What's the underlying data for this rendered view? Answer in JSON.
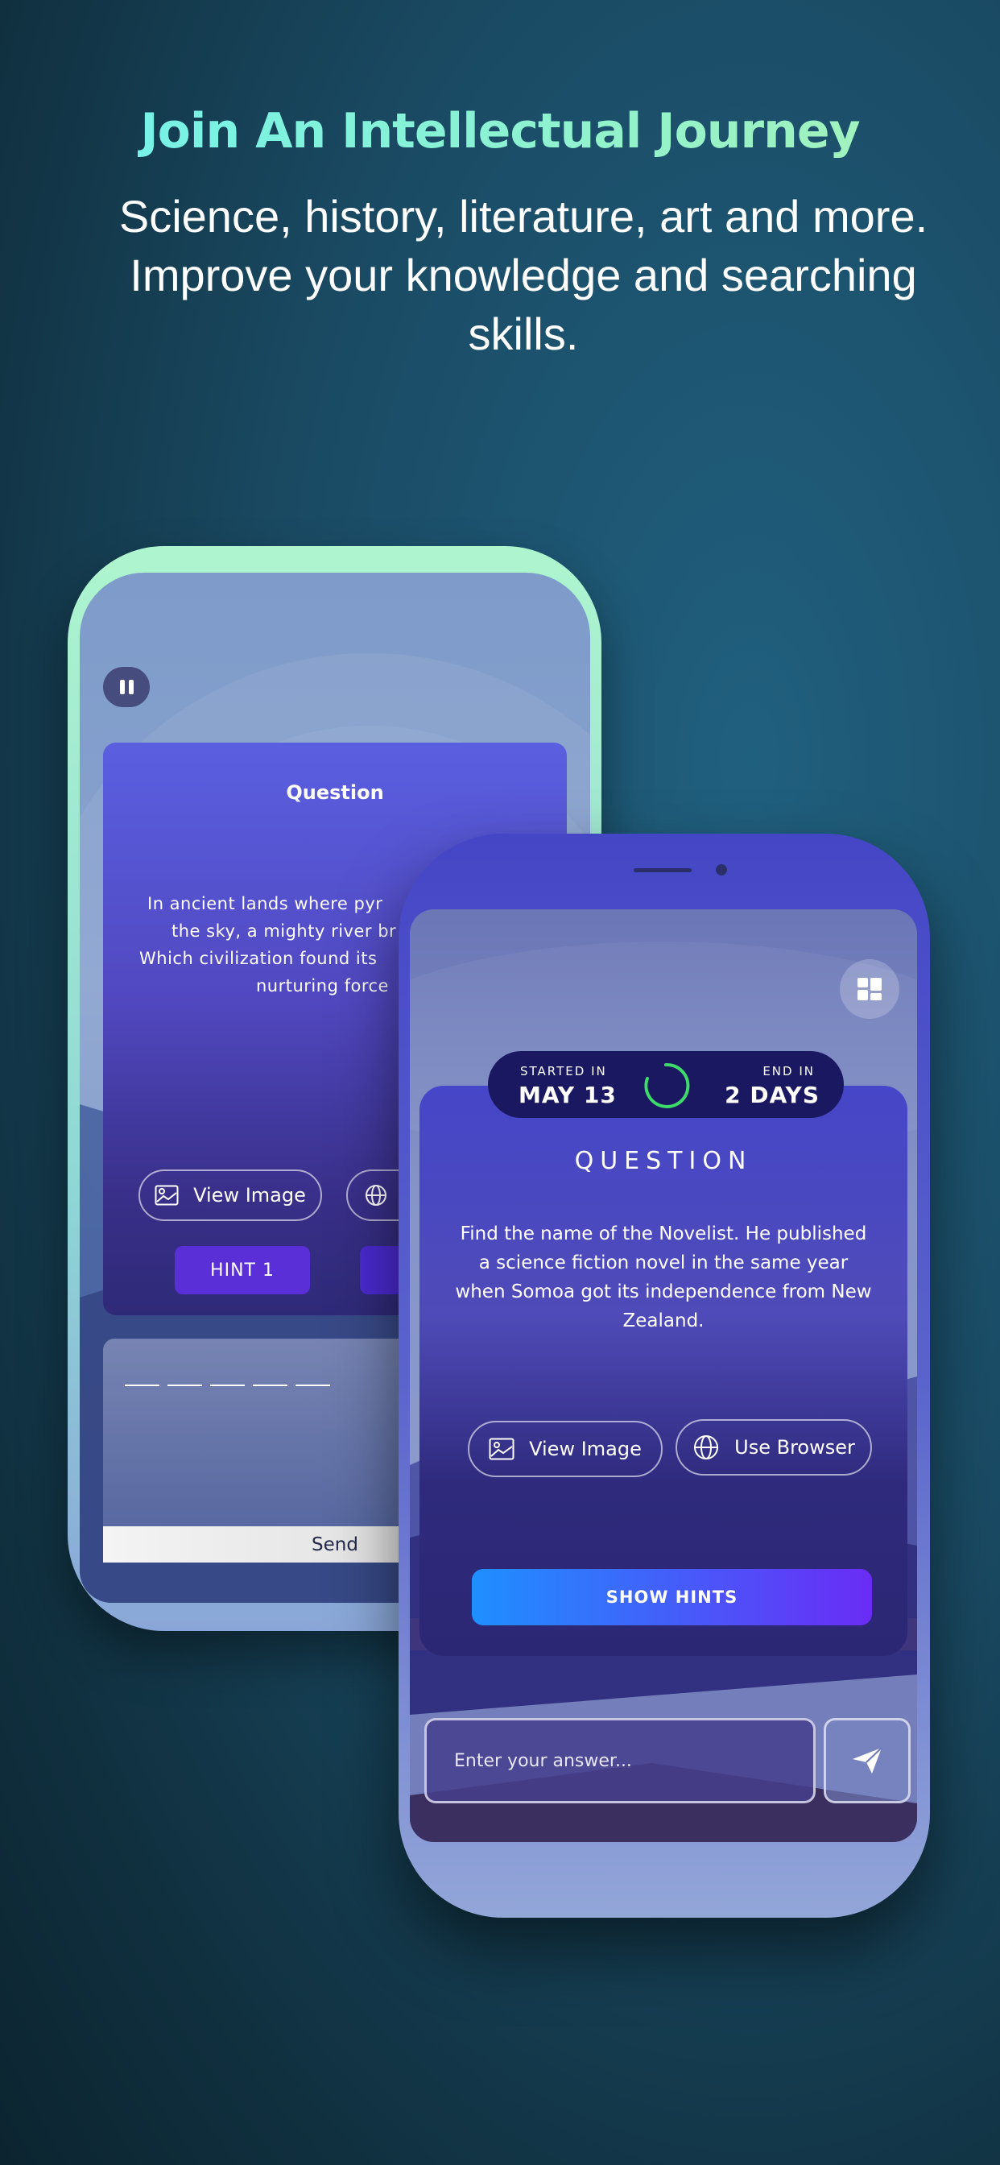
{
  "header": {
    "title": "Join An Intellectual Journey",
    "subtitle": "Science, history, literature, art and more. Improve your knowledge and searching skills."
  },
  "back_screen": {
    "pause_icon": "pause-icon",
    "question_title": "Question",
    "question_lines": [
      "In ancient lands where pyr",
      "the sky, a mighty river br",
      "Which civilization found its",
      "nurturing force"
    ],
    "view_image": "View Image",
    "hint1": "HINT 1",
    "send": "Send",
    "answer_slots": 5
  },
  "front_screen": {
    "menu_icon": "grid-icon",
    "started_label": "STARTED IN",
    "started_value": "MAY 13",
    "end_label": "END IN",
    "end_value": "2 DAYS",
    "question_title": "QUESTION",
    "question_text": "Find the name of the Novelist. He published a science fiction novel in the same year when Somoa got its independence from New Zealand.",
    "view_image": "View Image",
    "use_browser": "Use Browser",
    "show_hints": "SHOW HINTS",
    "answer_placeholder": "Enter your answer...",
    "send_icon": "send-icon"
  },
  "colors": {
    "title_gradient_start": "#6ff2ee",
    "title_gradient_end": "#a9f2b6",
    "hint_button": "#5b2fd8",
    "show_hints_start": "#1e90ff",
    "show_hints_end": "#6a2cf5",
    "timer_ring": "#3ddc6a"
  }
}
